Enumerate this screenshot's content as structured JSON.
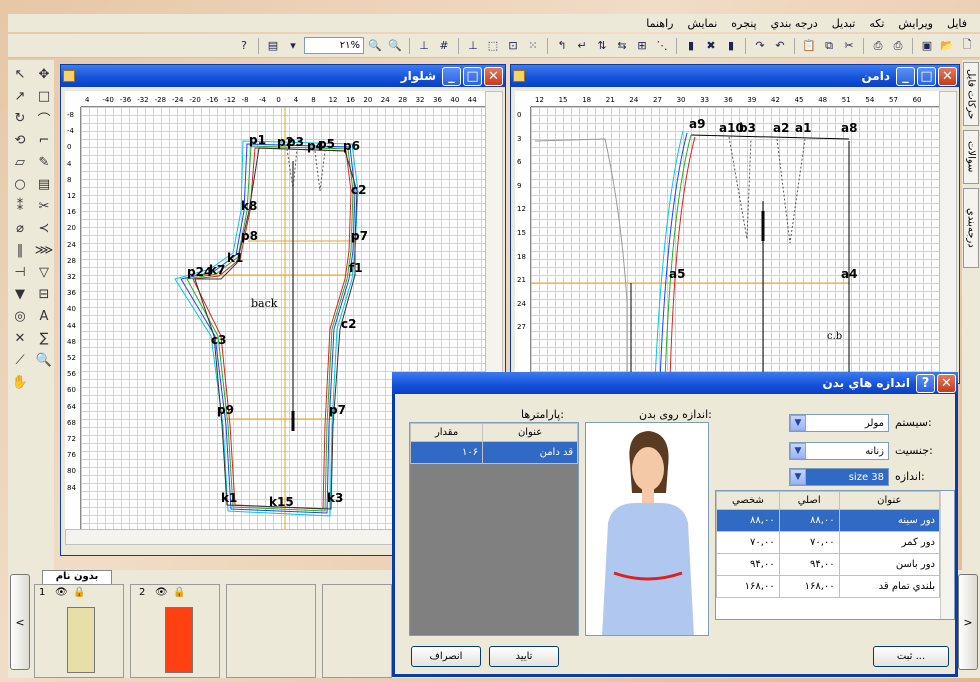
{
  "menu": [
    "فايل",
    "ويرايش",
    "تكه",
    "تبديل",
    "درجه بندي",
    "پنجره",
    "نمايش",
    "راهنما"
  ],
  "toolbar": {
    "zoom": "۲۱%"
  },
  "right_tabs": [
    "حركات فايل",
    "سوالات",
    "درجه‌بندي"
  ],
  "left_window": {
    "title": "شلوار",
    "label_back": "back",
    "ruler_h": [
      "4",
      "-40",
      "-36",
      "-32",
      "-28",
      "-24",
      "-20",
      "-16",
      "-12",
      "-8",
      "-4",
      "0",
      "4",
      "8",
      "12",
      "16",
      "20",
      "24",
      "28",
      "32",
      "36",
      "40",
      "44"
    ],
    "ruler_v": [
      "-8",
      "-4",
      "0",
      "4",
      "8",
      "12",
      "16",
      "20",
      "24",
      "28",
      "32",
      "36",
      "40",
      "44",
      "48",
      "52",
      "56",
      "60",
      "64",
      "68",
      "72",
      "76",
      "80",
      "84"
    ],
    "points": [
      "p1",
      "p2",
      "p3",
      "p4",
      "p5",
      "p6",
      "c2",
      "k8",
      "p8",
      "p7",
      "p24",
      "k7",
      "k1",
      "f1",
      "c2",
      "c3",
      "p9",
      "p7",
      "k1",
      "k15",
      "k3"
    ]
  },
  "right_window": {
    "title": "دامن",
    "label_cb": "c.b",
    "ruler_h": [
      "12",
      "15",
      "18",
      "21",
      "24",
      "27",
      "30",
      "33",
      "36",
      "39",
      "42",
      "45",
      "48",
      "51",
      "54",
      "57",
      "60"
    ],
    "ruler_v": [
      "0",
      "3",
      "6",
      "9",
      "12",
      "15",
      "18",
      "21",
      "24",
      "27"
    ],
    "points": [
      "a9",
      "a10",
      "b3",
      "a2",
      "a1",
      "a8",
      "a5",
      "a4"
    ]
  },
  "bottom": {
    "tab": "بدون نام",
    "layers": [
      "1",
      "2"
    ],
    "nav_prev": "<",
    "nav_next": ">"
  },
  "dialog": {
    "title": "اندازه هاي بدن",
    "system_label": "سيستم:",
    "system_value": "مولر",
    "gender_label": "جنسيت:",
    "gender_value": "زنانه",
    "size_label": "اندازه:",
    "size_value": "size 38",
    "figure_label": "اندازه روی بدن:",
    "params_label": "پارامترها:",
    "params_headers": [
      "عنوان",
      "مقدار"
    ],
    "params_rows": [
      [
        "قد دامن",
        "۱۰۶"
      ]
    ],
    "meas_headers": [
      "عنوان",
      "اصلي",
      "شخصي"
    ],
    "meas_rows": [
      [
        "دور سينه",
        "۸۸,۰۰",
        "۸۸,۰۰"
      ],
      [
        "دور كمر",
        "۷۰,۰۰",
        "۷۰,۰۰"
      ],
      [
        "دور باسن",
        "۹۴,۰۰",
        "۹۴,۰۰"
      ],
      [
        "بلندي تمام قد",
        "۱۶۸,۰۰",
        "۱۶۸,۰۰"
      ]
    ],
    "btn_save": "ثبت ...",
    "btn_ok": "تاييد",
    "btn_cancel": "انصراف"
  },
  "colors": {
    "title_blue": "#1450d8",
    "pattern_orange": "#f0a020",
    "tshirt": "#b0c8f0",
    "layer_red": "#ff4010",
    "layer_beige": "#e6e0a8"
  }
}
